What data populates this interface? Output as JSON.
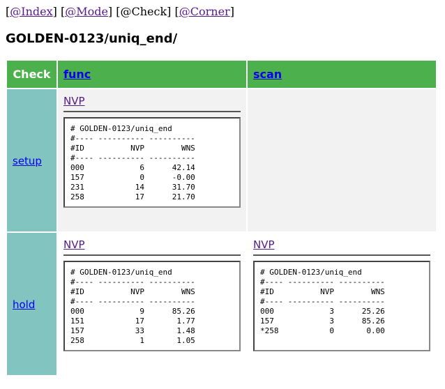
{
  "nav": {
    "open1": "[",
    "index": "@Index",
    "mid1": "] [",
    "mode": "@Mode",
    "mid2": "] [@Check] [",
    "corner": "@Corner",
    "close": "]"
  },
  "title": "GOLDEN-0123/uniq_end/",
  "table": {
    "header": {
      "check": "Check",
      "func": "func",
      "scan": "scan"
    },
    "rows": [
      {
        "label": "setup",
        "func": {
          "link": "NVP",
          "report": [
            "# GOLDEN-0123/uniq_end",
            "#---- ---------- ----------",
            "#ID          NVP        WNS",
            "#---- ---------- ----------",
            "000            6      42.14",
            "157            0      -0.00",
            "231           14      31.70",
            "258           17      21.70"
          ]
        }
      },
      {
        "label": "hold",
        "func": {
          "link": "NVP",
          "report": [
            "# GOLDEN-0123/uniq_end",
            "#---- ---------- ----------",
            "#ID          NVP        WNS",
            "#---- ---------- ----------",
            "000            9      85.26",
            "151           17       1.77",
            "157           33       1.48",
            "258            1       1.05"
          ]
        },
        "scan": {
          "link": "NVP",
          "report": [
            "# GOLDEN-0123/uniq_end",
            "#---- ---------- ----------",
            "#ID          NVP        WNS",
            "#---- ---------- ----------",
            "000            3      25.26",
            "157            3      85.26",
            "*258           0       0.00"
          ]
        }
      }
    ]
  },
  "colors": {
    "header_bg": "#4cb04c",
    "row_label_bg": "#82c4c0",
    "setup_row_bg": "#f2f2f2",
    "link": "#0000ee",
    "visited_link": "#551a8b"
  }
}
